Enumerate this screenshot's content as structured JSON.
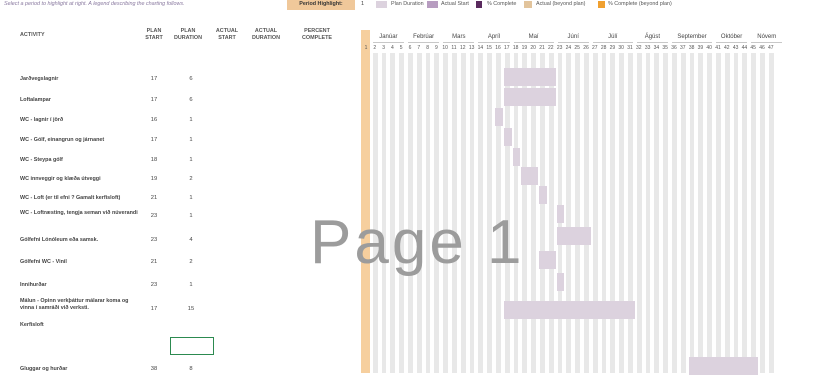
{
  "subtitle": "Select a period to highlight at right. A legend describing the charting follows.",
  "period_highlight": {
    "label": "Period Highlight:",
    "value": "1"
  },
  "legend": [
    {
      "label": "Plan Duration",
      "color": "#dcd2de"
    },
    {
      "label": "Actual Start",
      "color": "#b79cc0"
    },
    {
      "label": "% Complete",
      "color": "#5a2a5e"
    },
    {
      "label": "Actual (beyond plan)",
      "color": "#e2c49c"
    },
    {
      "label": "% Complete (beyond plan)",
      "color": "#f0a030"
    }
  ],
  "headers": {
    "activity": "ACTIVITY",
    "plan_start": "PLAN START",
    "plan_duration": "PLAN DURATION",
    "actual_start": "ACTUAL START",
    "actual_duration": "ACTUAL DURATION",
    "percent_complete": "PERCENT COMPLETE"
  },
  "months": [
    "Janúar",
    "Febrúar",
    "Mars",
    "Apríl",
    "Maí",
    "Júní",
    "Júlí",
    "Ágúst",
    "September",
    "Október",
    "Nóvem"
  ],
  "periods": [
    "1",
    "2",
    "3",
    "4",
    "5",
    "6",
    "7",
    "8",
    "9",
    "10",
    "11",
    "12",
    "13",
    "14",
    "15",
    "16",
    "17",
    "18",
    "19",
    "20",
    "21",
    "22",
    "23",
    "24",
    "25",
    "26",
    "27",
    "28",
    "29",
    "30",
    "31",
    "32",
    "33",
    "34",
    "35",
    "36",
    "37",
    "38",
    "39",
    "40",
    "41",
    "42",
    "43",
    "44",
    "45",
    "46",
    "47"
  ],
  "activities": [
    {
      "name": "Jarðvegslagnir",
      "plan_start": 17,
      "plan_duration": 6
    },
    {
      "name": "Loftalampar",
      "plan_start": 17,
      "plan_duration": 6
    },
    {
      "name": "WC - lagnir í jörð",
      "plan_start": 16,
      "plan_duration": 1
    },
    {
      "name": "WC - Gólf, einangrun og járnanet",
      "plan_start": 17,
      "plan_duration": 1
    },
    {
      "name": "WC - Steypa gólf",
      "plan_start": 18,
      "plan_duration": 1
    },
    {
      "name": "WC innveggir og klæða útveggi",
      "plan_start": 19,
      "plan_duration": 2
    },
    {
      "name": "WC - Loft (er til efni ? Gamalt kerfisloft)",
      "plan_start": 21,
      "plan_duration": 1
    },
    {
      "name": "WC - Loftræsting, tengja seman við núverandi",
      "plan_start": 23,
      "plan_duration": 1
    },
    {
      "name": "Gólfefni Lónóleum eða samsk.",
      "plan_start": 23,
      "plan_duration": 4
    },
    {
      "name": "Gólfefni WC - Vinil",
      "plan_start": 21,
      "plan_duration": 2
    },
    {
      "name": "Innihurðar",
      "plan_start": 23,
      "plan_duration": 1
    },
    {
      "name": "Málun - Opinn verkþáttur málarar koma og vinna í samráði við verksti.",
      "plan_start": 17,
      "plan_duration": 15
    },
    {
      "name": "Kerfisloft",
      "plan_start": null,
      "plan_duration": null
    },
    {
      "name": "Gluggar og hurðar",
      "plan_start": 38,
      "plan_duration": 8
    }
  ],
  "watermark": "Page 1"
}
